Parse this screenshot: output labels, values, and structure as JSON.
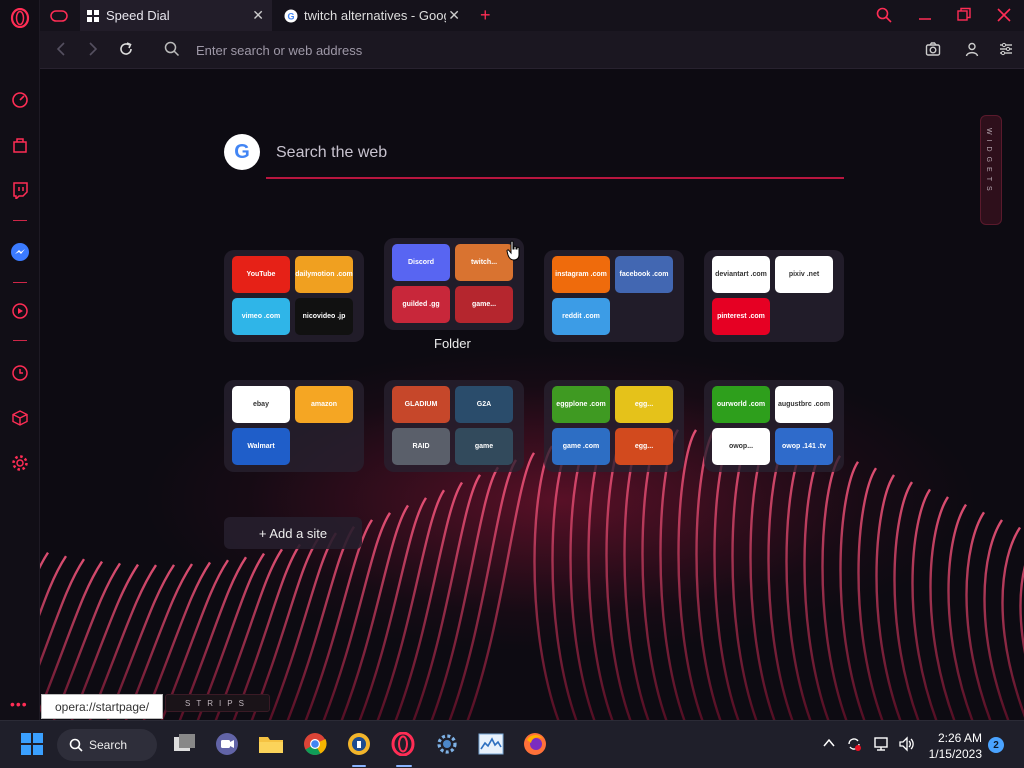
{
  "browser": {
    "tabs": [
      {
        "label": "Speed Dial"
      },
      {
        "label": "twitch alternatives - Google"
      }
    ],
    "address_placeholder": "Enter search or web address"
  },
  "speed_dial": {
    "search_placeholder": "Search the web",
    "widgets_label": "WIDGETS",
    "folder_label": "Folder",
    "add_site_label": "+ Add a site",
    "strips_label": "STRIPS",
    "status_url": "opera://startpage/",
    "groups": [
      {
        "tiles": [
          {
            "label": "YouTube",
            "color": "#e62117"
          },
          {
            "label": "dailymotion .com",
            "color": "#f0a020"
          },
          {
            "label": "vimeo .com",
            "color": "#2fb5e8"
          },
          {
            "label": "nicovideo .jp",
            "color": "#111111"
          }
        ]
      },
      {
        "tiles": [
          {
            "label": "Discord",
            "color": "#5865f2"
          },
          {
            "label": "twitch...",
            "color": "#d97330"
          },
          {
            "label": "guilded .gg",
            "color": "#c8273a"
          },
          {
            "label": "game...",
            "color": "#b5262e"
          }
        ]
      },
      {
        "tiles": [
          {
            "label": "instagram .com",
            "color": "#ef6b0c"
          },
          {
            "label": "facebook .com",
            "color": "#4267b2"
          },
          {
            "label": "reddit .com",
            "color": "#3c9ce6"
          }
        ]
      },
      {
        "tiles": [
          {
            "label": "deviantart .com",
            "color": "#ffffff"
          },
          {
            "label": "pixiv .net",
            "color": "#ffffff"
          },
          {
            "label": "pinterest .com",
            "color": "#e60023"
          }
        ]
      },
      {
        "tiles": [
          {
            "label": "ebay",
            "color": "#ffffff"
          },
          {
            "label": "amazon",
            "color": "#f5a623"
          },
          {
            "label": "Walmart",
            "color": "#1f5ec9"
          }
        ]
      },
      {
        "tiles": [
          {
            "label": "GLADIUM",
            "color": "#c6472a"
          },
          {
            "label": "G2A",
            "color": "#2a4c6b"
          },
          {
            "label": "RAID",
            "color": "#5a5f6a"
          },
          {
            "label": "game",
            "color": "#324a5c"
          }
        ]
      },
      {
        "tiles": [
          {
            "label": "eggplone .com",
            "color": "#3f9a22"
          },
          {
            "label": "egg...",
            "color": "#e5c21a"
          },
          {
            "label": "game .com",
            "color": "#2d6ec4"
          },
          {
            "label": "egg...",
            "color": "#d24a1e"
          }
        ]
      },
      {
        "tiles": [
          {
            "label": "ourworld .com",
            "color": "#2e9f1c"
          },
          {
            "label": "augustbrc .com",
            "color": "#ffffff"
          },
          {
            "label": "owop...",
            "color": "#ffffff"
          },
          {
            "label": "owop .141 .tv",
            "color": "#2f6bcb"
          }
        ]
      }
    ]
  },
  "taskbar": {
    "search_label": "Search",
    "time": "2:26 AM",
    "date": "1/15/2023",
    "notification_count": "2"
  }
}
